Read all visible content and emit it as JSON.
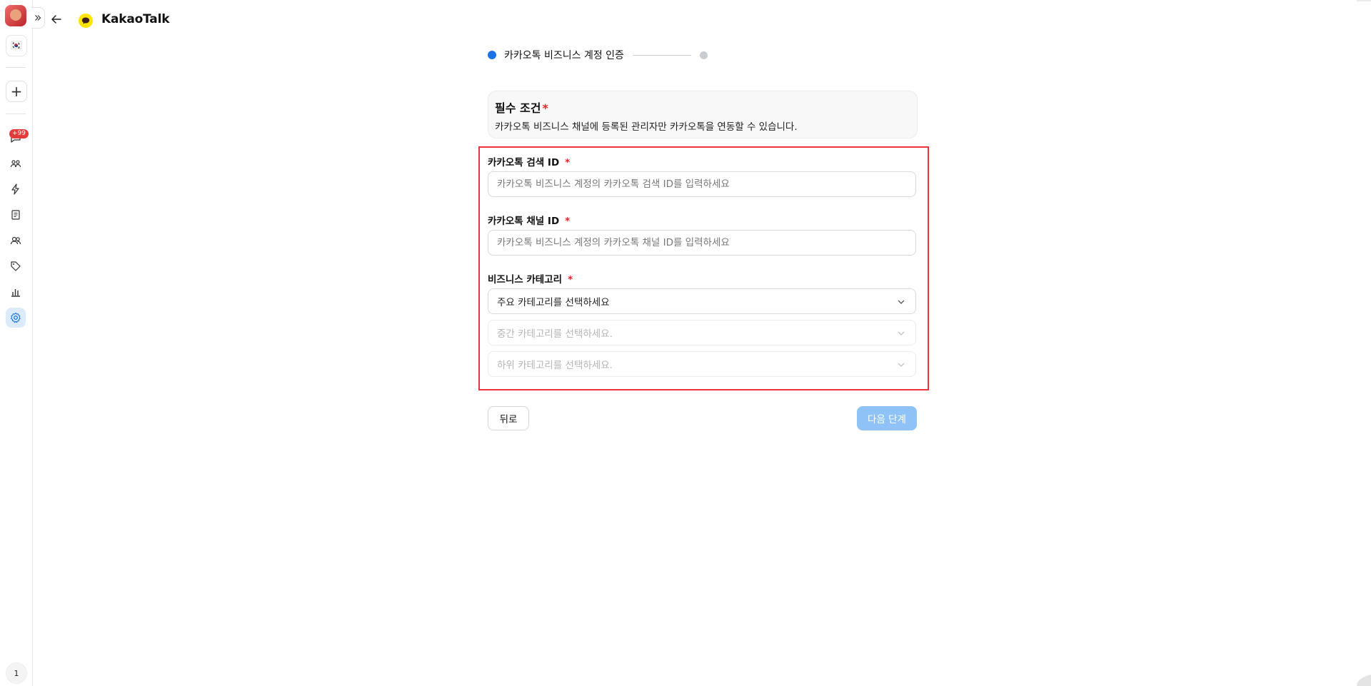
{
  "sidebar": {
    "flag_icon": "🇰🇷",
    "add_label": "+",
    "badge": "+99",
    "page_number": "1",
    "nav_icons": [
      "chat-icon",
      "people-icon",
      "bolt-icon",
      "document-icon",
      "contacts-icon",
      "tag-icon",
      "bar-chart-icon",
      "settings-icon"
    ]
  },
  "header": {
    "title": "KakaoTalk"
  },
  "stepper": {
    "step1_label": "카카오톡 비즈니스 계정 인증"
  },
  "requirement": {
    "title": "필수 조건",
    "star": "*",
    "description": "카카오톡 비즈니스 채널에 등록된 관리자만 카카오톡을 연동할 수 있습니다."
  },
  "form": {
    "search_id": {
      "label": "카카오톡 검색 ID",
      "star": "*",
      "placeholder": "카카오톡 비즈니스 계정의 카카오톡 검색 ID를 입력하세요"
    },
    "channel_id": {
      "label": "카카오톡 채널 ID",
      "star": "*",
      "placeholder": "카카오톡 비즈니스 계정의 카카오톡 채널 ID를 입력하세요"
    },
    "category": {
      "label": "비즈니스 카테고리",
      "star": "*",
      "main": "주요 카테고리를 선택하세요",
      "middle": "중간 카테고리를 선택하세요.",
      "sub": "하위 카테고리를 선택하세요."
    }
  },
  "actions": {
    "back": "뒤로",
    "next": "다음 단계"
  },
  "colors": {
    "accent": "#1a73e8",
    "next_button": "#8fc3f7",
    "required_star": "#e02424",
    "highlight": "#ee3338",
    "kakao_yellow": "#fee500"
  }
}
